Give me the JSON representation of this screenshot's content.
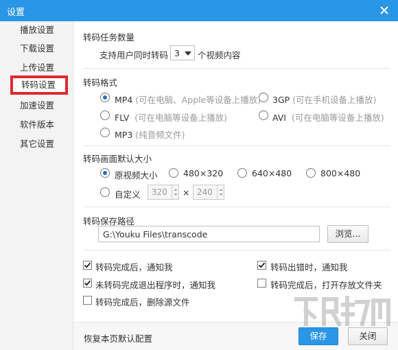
{
  "window": {
    "title": "设置"
  },
  "sidebar": {
    "items": [
      {
        "label": "播放设置"
      },
      {
        "label": "下载设置"
      },
      {
        "label": "上传设置"
      },
      {
        "label": "转码设置"
      },
      {
        "label": "加速设置"
      },
      {
        "label": "软件版本"
      },
      {
        "label": "其它设置"
      }
    ],
    "active_index": 3
  },
  "tasks": {
    "section_title": "转码任务数量",
    "prefix": "支持用户同时转码",
    "value": "3",
    "suffix": "个视频内容"
  },
  "format": {
    "section_title": "转码格式",
    "options": [
      {
        "name": "MP4",
        "hint": "(可在电脑、Apple等设备上播放)",
        "checked": true
      },
      {
        "name": "3GP",
        "hint": "(可在手机设备上播放)",
        "checked": false
      },
      {
        "name": "FLV",
        "hint": "(可在电脑等设备上播放)",
        "checked": false
      },
      {
        "name": "AVI",
        "hint": "(可在电脑等设备上播放)",
        "checked": false
      },
      {
        "name": "MP3",
        "hint": "(纯音频文件)",
        "checked": false
      }
    ]
  },
  "size": {
    "section_title": "转码画面默认大小",
    "options": [
      {
        "label": "原视频大小",
        "checked": true
      },
      {
        "label": "480×320",
        "checked": false
      },
      {
        "label": "640×480",
        "checked": false
      },
      {
        "label": "800×480",
        "checked": false
      }
    ],
    "custom_label": "自定义",
    "custom_width": "320",
    "custom_height": "240",
    "times": "×"
  },
  "path": {
    "section_title": "转码保存路径",
    "value": "G:\\Youku Files\\transcode",
    "browse_label": "浏览..."
  },
  "notify": {
    "options": [
      {
        "label": "转码完成后，通知我",
        "checked": true
      },
      {
        "label": "转码出错时，通知我",
        "checked": true
      },
      {
        "label": "未转码完成退出程序时，通知我",
        "checked": true
      },
      {
        "label": "转码完成后，打开存放文件夹",
        "checked": false
      },
      {
        "label": "转码完成后，删除源文件",
        "checked": false
      }
    ]
  },
  "footer": {
    "reset_label": "恢复本页默认配置",
    "save_label": "保存",
    "close_label": "关闭"
  },
  "colors": {
    "accent": "#2a96e6",
    "highlight": "#e0282f"
  }
}
